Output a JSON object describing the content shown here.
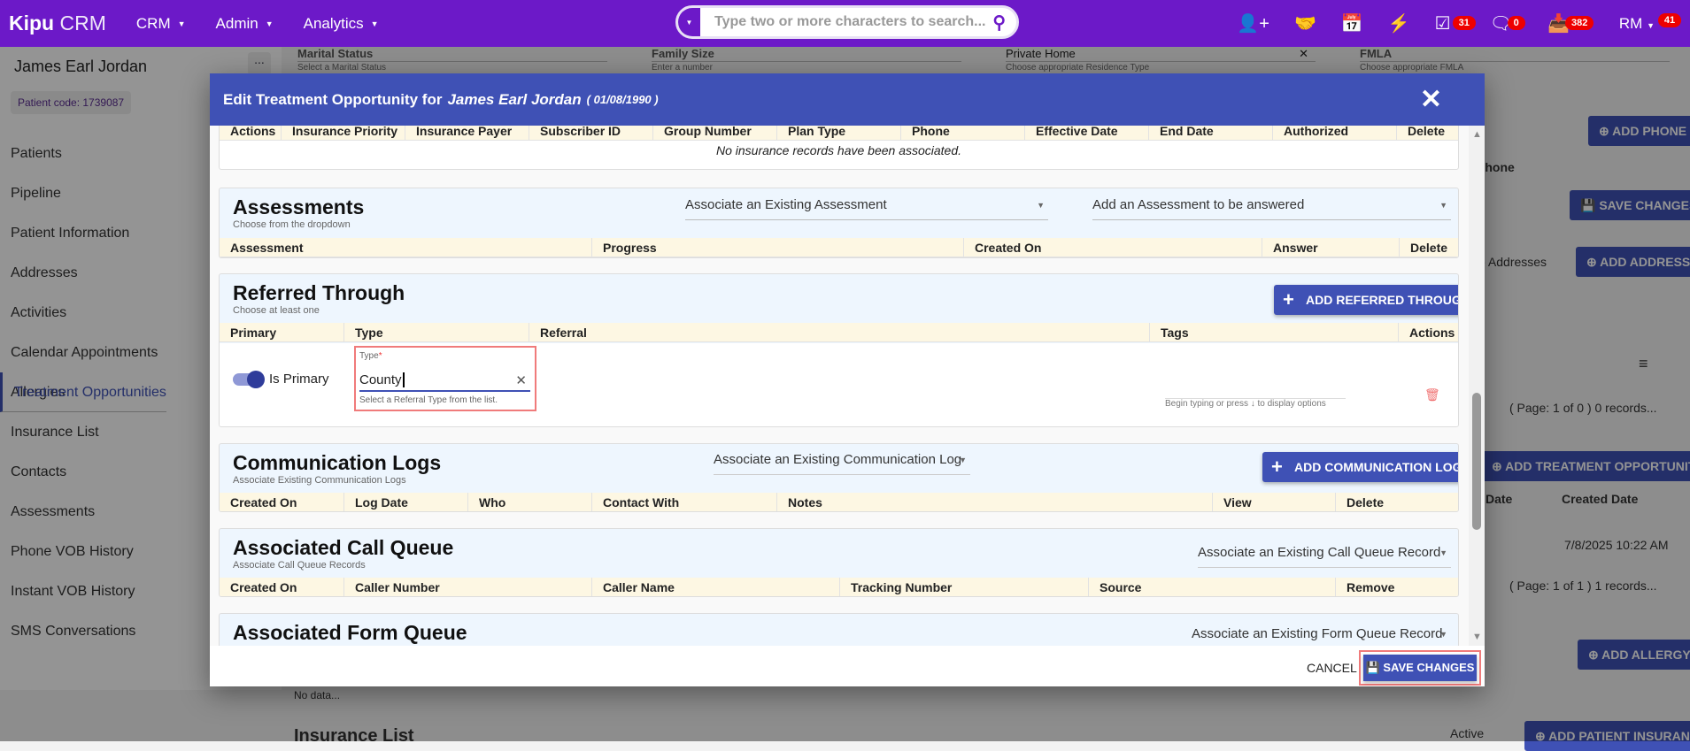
{
  "topbar": {
    "logo_bold": "Kipu",
    "logo_light": "CRM",
    "nav": [
      "CRM",
      "Admin",
      "Analytics"
    ],
    "search_placeholder": "Type two or more characters to search...",
    "icons": [
      "add-user-icon",
      "handshake-icon",
      "calendar-icon",
      "lightning-icon",
      "checklist-icon",
      "chat-icon",
      "inbox-icon"
    ],
    "badges": {
      "tasks": "31",
      "messages": "0",
      "inbox": "382",
      "user": "41"
    },
    "user_initials": "RM",
    "color": "#6c19c8"
  },
  "sidebar": {
    "patient_name": "James Earl Jordan",
    "patient_code": "Patient code: 1739087",
    "more": "...",
    "items": [
      "Patients",
      "Pipeline",
      "Patient Information",
      "Addresses",
      "Activities",
      "Calendar Appointments",
      "Treatment Opportunities",
      "Allergies",
      "Insurance List",
      "Contacts",
      "Assessments",
      "Phone VOB History",
      "Instant VOB History",
      "SMS Conversations"
    ],
    "selected": "Treatment Opportunities"
  },
  "background": {
    "fields": [
      {
        "label": "Marital Status",
        "hint": "Select a Marital Status"
      },
      {
        "label": "Family Size",
        "hint": "Enter a number"
      },
      {
        "label": "Private Home",
        "hint": "Choose appropriate Residence Type"
      },
      {
        "label": "FMLA",
        "hint": "Choose appropriate FMLA"
      }
    ],
    "add_phone": "ADD PHONE",
    "phone_col": "Phone",
    "save_changes": "SAVE CHANGES",
    "addresses_text": "e Addresses",
    "add_address": "ADD ADDRESS",
    "page_0": "( Page: 1 of 0 ) 0 records...",
    "add_treatment": "ADD TREATMENT OPPORTUNITY",
    "date_col": "Date",
    "created_date_col": "Created Date",
    "created_date_value": "7/8/2025 10:22 AM",
    "page_1": "( Page: 1 of 1 ) 1 records...",
    "add_allergy": "ADD ALLERGY",
    "no_data": "No data...",
    "insurance_list": "Insurance List",
    "active": "Active",
    "add_patient_insurance": "ADD PATIENT INSURANCE"
  },
  "modal": {
    "title_prefix": "Edit Treatment Opportunity for",
    "patient": "James Earl Jordan",
    "dob": "( 01/08/1990 )",
    "color": "#3f51b5",
    "insurance": {
      "columns": [
        "Actions",
        "Insurance Priority",
        "Insurance Payer",
        "Subscriber ID",
        "Group Number",
        "Plan Type",
        "Phone",
        "Effective Date",
        "End Date",
        "Authorized",
        "Delete"
      ],
      "empty": "No insurance records have been associated."
    },
    "assessments": {
      "title": "Assessments",
      "subtitle": "Choose from the dropdown",
      "select_existing": "Associate an Existing Assessment",
      "select_add": "Add an Assessment to be answered",
      "columns": [
        "Assessment",
        "Progress",
        "Created On",
        "Answer",
        "Delete"
      ]
    },
    "referred": {
      "title": "Referred Through",
      "subtitle": "Choose at least one",
      "add_button": "ADD REFERRED THROUGH",
      "columns": [
        "Primary",
        "Type",
        "Referral",
        "Tags",
        "Actions"
      ],
      "row": {
        "primary_label": "Is Primary",
        "primary_on": true,
        "type_label": "Type",
        "required": "*",
        "type_value": "County",
        "type_hint": "Select a Referral Type from the list.",
        "tags_hint": "Begin typing or press ↓ to display options"
      }
    },
    "comm_logs": {
      "title": "Communication Logs",
      "subtitle": "Associate Existing Communication Logs",
      "select_existing": "Associate an Existing Communication Log",
      "add_button": "ADD COMMUNICATION LOG",
      "columns": [
        "Created On",
        "Log Date",
        "Who",
        "Contact With",
        "Notes",
        "View",
        "Delete"
      ]
    },
    "call_queue": {
      "title": "Associated Call Queue",
      "subtitle": "Associate Call Queue Records",
      "select_existing": "Associate an Existing Call Queue Record",
      "columns": [
        "Created On",
        "Caller Number",
        "Caller Name",
        "Tracking Number",
        "Source",
        "Remove"
      ]
    },
    "form_queue": {
      "title": "Associated Form Queue",
      "select_existing": "Associate an Existing Form Queue Record"
    },
    "footer": {
      "cancel": "CANCEL",
      "save": "SAVE CHANGES"
    }
  }
}
